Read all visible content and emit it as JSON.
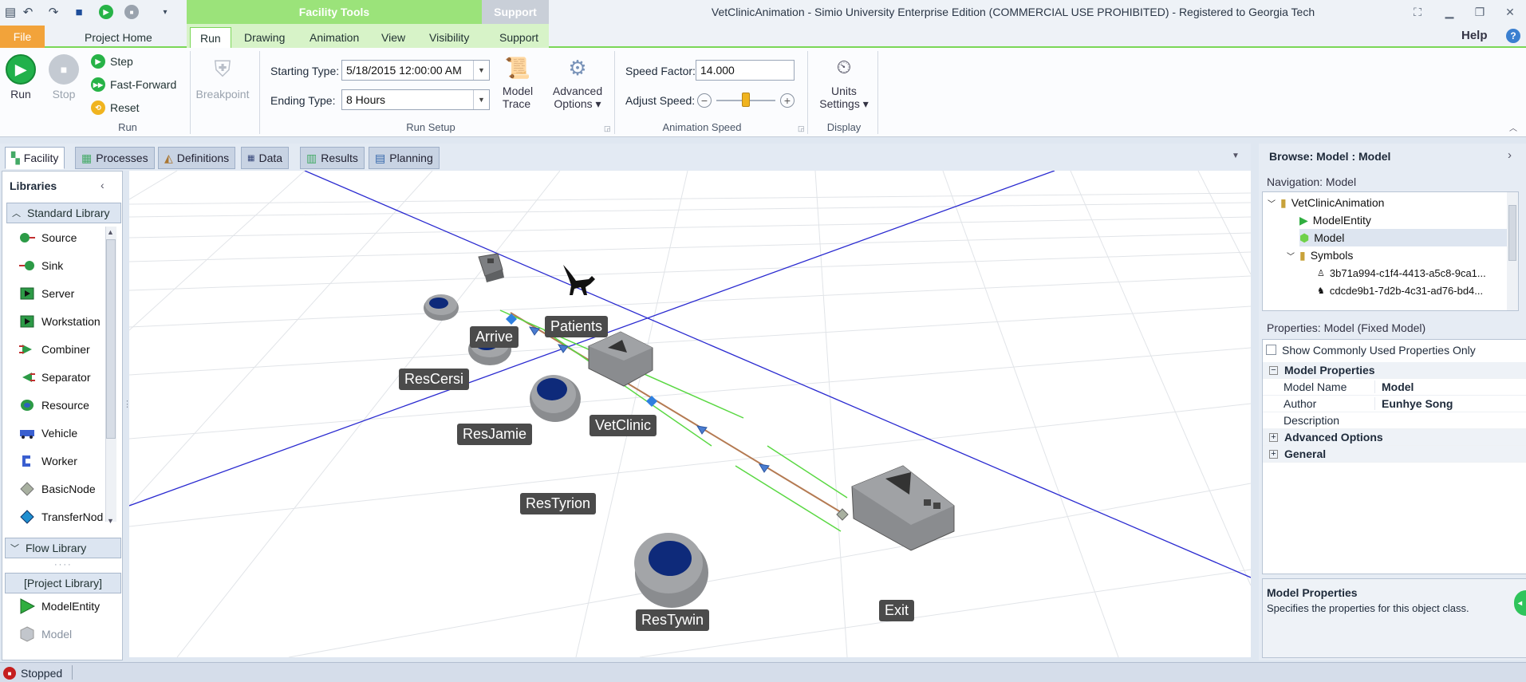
{
  "window": {
    "title": "VetClinicAnimation - Simio University Enterprise Edition (COMMERCIAL USE PROHIBITED) - Registered to Georgia Tech",
    "context_tab": "Facility Tools",
    "context_tab_support": "Support",
    "help": "Help"
  },
  "ribbon_tabs": [
    "File",
    "Project Home",
    "Run",
    "Drawing",
    "Animation",
    "View",
    "Visibility",
    "Support"
  ],
  "ribbon": {
    "run_label": "Run",
    "stop_label": "Stop",
    "step_label": "Step",
    "fast_forward_label": "Fast-Forward",
    "reset_label": "Reset",
    "run_group": "Run",
    "breakpoint_label": "Breakpoint",
    "starting_type_label": "Starting Type:",
    "starting_type_value": "5/18/2015 12:00:00 AM",
    "ending_type_label": "Ending Type:",
    "ending_type_value": "8 Hours",
    "model_trace_label1": "Model",
    "model_trace_label2": "Trace",
    "advanced_options_label1": "Advanced",
    "advanced_options_label2": "Options",
    "run_setup_group": "Run Setup",
    "speed_factor_label": "Speed Factor:",
    "speed_factor_value": "14.000",
    "adjust_speed_label": "Adjust Speed:",
    "adjust_speed_level": 0.5,
    "animation_speed_group": "Animation Speed",
    "units_settings_label1": "Units",
    "units_settings_label2": "Settings",
    "display_group": "Display"
  },
  "doc_tabs": [
    "Facility",
    "Processes",
    "Definitions",
    "Data",
    "Results",
    "Planning"
  ],
  "libraries": {
    "title": "Libraries",
    "standard_library": "Standard Library",
    "items": [
      "Source",
      "Sink",
      "Server",
      "Workstation",
      "Combiner",
      "Separator",
      "Resource",
      "Vehicle",
      "Worker",
      "BasicNode",
      "TransferNod"
    ],
    "flow_library": "Flow Library",
    "project_library": "[Project Library]",
    "project_items": [
      "ModelEntity",
      "Model"
    ]
  },
  "facility": {
    "labels": [
      "Arrive",
      "Patients",
      "ResCersi",
      "VetClinic",
      "ResJamie",
      "ResTyrion",
      "ResTywin",
      "Exit"
    ]
  },
  "browse": {
    "title": "Browse: Model : Model",
    "navigation_title": "Navigation: Model",
    "tree": [
      "VetClinicAnimation",
      "ModelEntity",
      "Model",
      "Symbols",
      "3b71a994-c1f4-4413-a5c8-9ca1...",
      "cdcde9b1-7d2b-4c31-ad76-bd4..."
    ],
    "properties_title": "Properties: Model (Fixed Model)",
    "show_common": "Show Commonly Used Properties Only",
    "model_properties": "Model Properties",
    "rows": [
      {
        "name": "Model Name",
        "value": "Model"
      },
      {
        "name": "Author",
        "value": "Eunhye Song"
      },
      {
        "name": "Description",
        "value": ""
      }
    ],
    "advanced_options": "Advanced Options",
    "general": "General",
    "desc_title": "Model Properties",
    "desc_text": "Specifies the properties for this object class."
  },
  "status": {
    "text": "Stopped"
  },
  "colors": {
    "accent_green": "#7ad757",
    "file_orange": "#f2a33a",
    "axis_blue": "#2a2ad0"
  }
}
